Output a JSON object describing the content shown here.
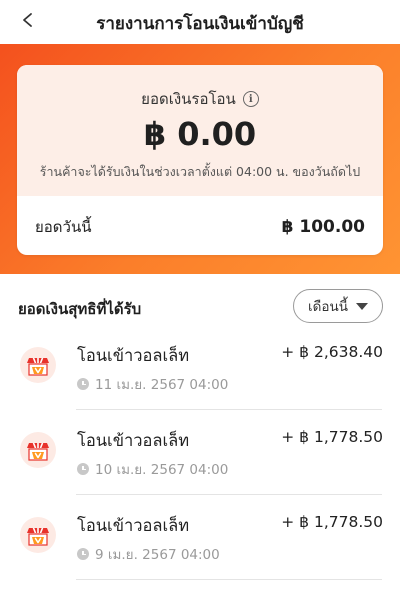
{
  "header": {
    "title": "รายงานการโอนเงินเข้าบัญชี"
  },
  "pending": {
    "label": "ยอดเงินรอโอน",
    "amount": "฿ 0.00",
    "note": "ร้านค้าจะได้รับเงินในช่วงเวลาตั้งแต่  04:00 น. ของวันถัดไป"
  },
  "today": {
    "label": "ยอดวันนี้",
    "amount": "฿ 100.00"
  },
  "section": {
    "title": "ยอดเงินสุทธิที่ได้รับ",
    "filter_label": "เดือนนี้"
  },
  "transactions": [
    {
      "title": "โอนเข้าวอลเล็ท",
      "date": "11 เม.ย. 2567 04:00",
      "amount": "+ ฿ 2,638.40"
    },
    {
      "title": "โอนเข้าวอลเล็ท",
      "date": "10 เม.ย. 2567 04:00",
      "amount": "+ ฿ 1,778.50"
    },
    {
      "title": "โอนเข้าวอลเล็ท",
      "date": "9 เม.ย. 2567 04:00",
      "amount": "+ ฿ 1,778.50"
    }
  ],
  "colors": {
    "accent": "#f4511e",
    "accent_light": "#ff9433",
    "card_tint": "#fdeee7",
    "muted_text": "#9a9a9a"
  },
  "icons": {
    "back": "chevron-left-icon",
    "info": "info-icon",
    "filter_caret": "caret-down-icon",
    "merchant": "shop-wallet-icon",
    "time": "clock-icon"
  }
}
